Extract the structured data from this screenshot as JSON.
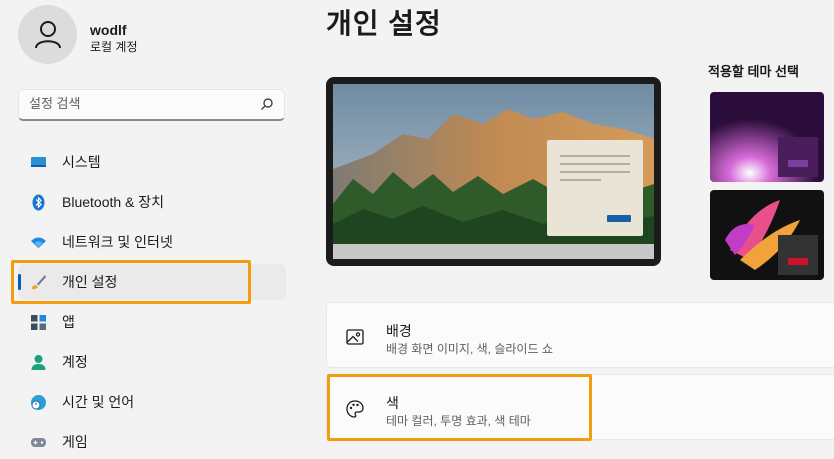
{
  "user": {
    "name": "wodlf",
    "account_type": "로컬 계정"
  },
  "search": {
    "placeholder": "설정 검색"
  },
  "nav": {
    "items": [
      {
        "label": "시스템",
        "icon": "monitor-icon"
      },
      {
        "label": "Bluetooth & 장치",
        "icon": "bluetooth-icon"
      },
      {
        "label": "네트워크 및 인터넷",
        "icon": "wifi-icon"
      },
      {
        "label": "개인 설정",
        "icon": "brush-icon",
        "active": true
      },
      {
        "label": "앱",
        "icon": "apps-icon"
      },
      {
        "label": "계정",
        "icon": "person-icon"
      },
      {
        "label": "시간 및 언어",
        "icon": "globe-clock-icon"
      },
      {
        "label": "게임",
        "icon": "gamepad-icon"
      }
    ]
  },
  "main": {
    "title": "개인 설정",
    "themes_label": "적용할 테마 선택",
    "cards": [
      {
        "title": "배경",
        "subtitle": "배경 화면 이미지, 색, 슬라이드 쇼",
        "icon": "image-icon"
      },
      {
        "title": "색",
        "subtitle": "테마 컬러, 투명 효과, 색 테마",
        "icon": "palette-icon"
      }
    ]
  },
  "colors": {
    "accent": "#005fb8",
    "highlight": "#f39c12"
  }
}
